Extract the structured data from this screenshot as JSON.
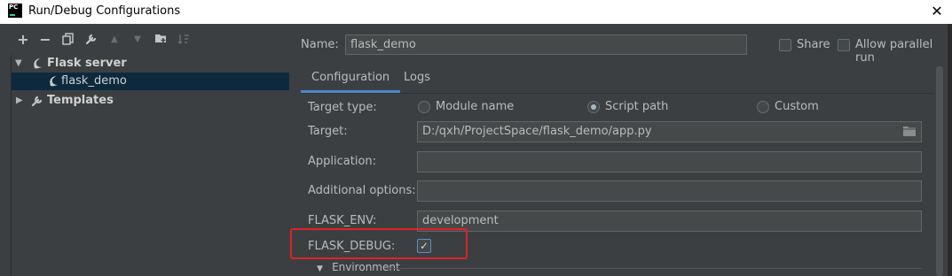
{
  "window": {
    "title": "Run/Debug Configurations",
    "app_icon": "PC",
    "close_glyph": "✕"
  },
  "toolbar": {
    "add": "+",
    "remove": "−",
    "copy": "copy-icon",
    "edit": "wrench-icon",
    "up": "▲",
    "down": "▼",
    "folder": "folder-add-icon",
    "sort": "sort-icon"
  },
  "tree": {
    "items": [
      {
        "label": "Flask server",
        "expanded": true,
        "level": 0,
        "bold": true
      },
      {
        "label": "flask_demo",
        "level": 1,
        "selected": true
      },
      {
        "label": "Templates",
        "expanded": false,
        "level": 0,
        "bold": true
      }
    ]
  },
  "header": {
    "name_label": "Name:",
    "name_value": "flask_demo",
    "share_label": "Share",
    "share_checked": false,
    "parallel_label": "Allow parallel run",
    "parallel_checked": false
  },
  "tabs": [
    {
      "label": "Configuration",
      "active": true
    },
    {
      "label": "Logs",
      "active": false
    }
  ],
  "form": {
    "target_type_label": "Target type:",
    "target_type_options": [
      "Module name",
      "Script path",
      "Custom"
    ],
    "target_type_selected": "Script path",
    "target_label": "Target:",
    "target_value": "D:/qxh/ProjectSpace/flask_demo/app.py",
    "application_label": "Application:",
    "application_value": "",
    "additional_options_label": "Additional options:",
    "additional_options_value": "",
    "flask_env_label": "FLASK_ENV:",
    "flask_env_value": "development",
    "flask_debug_label": "FLASK_DEBUG:",
    "flask_debug_checked": true,
    "check_glyph": "✓",
    "environment_label": "Environment",
    "environment_arrow": "▼"
  },
  "colors": {
    "highlight": "#e0212b",
    "tab_accent": "#4a88c7",
    "selection": "#0d293e",
    "background": "#3c3f41"
  }
}
